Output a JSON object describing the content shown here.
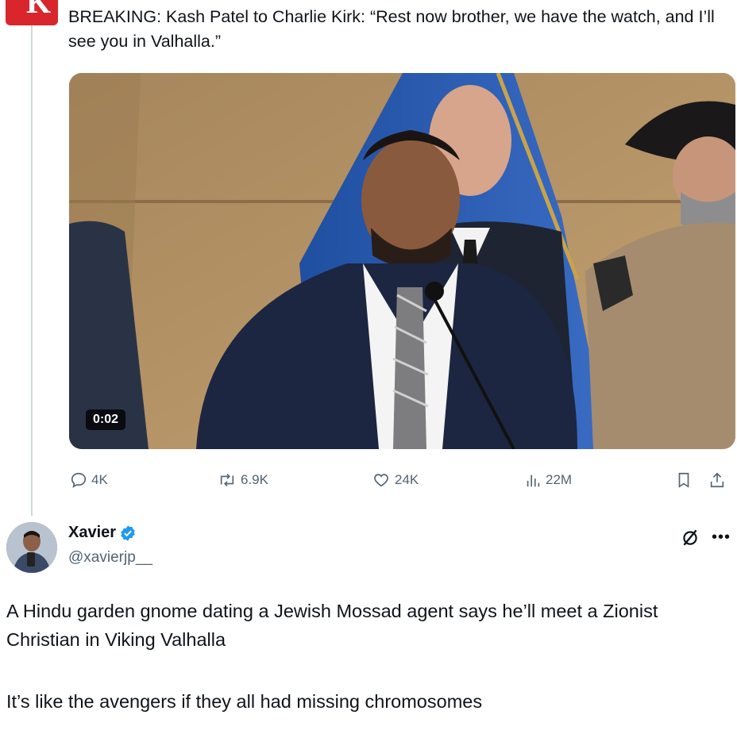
{
  "quoted_post": {
    "avatar_letter": "K",
    "text": "BREAKING: Kash Patel to Charlie Kirk: “Rest now brother, we have the watch, and I’ll see you in Valhalla.”",
    "video": {
      "duration": "0:02"
    },
    "actions": {
      "replies": "4K",
      "reposts": "6.9K",
      "likes": "24K",
      "views": "22M"
    }
  },
  "reply_post": {
    "author_name": "Xavier",
    "author_handle": "@xavierjp__",
    "verified": true,
    "text_line_1": "A Hindu garden gnome dating a Jewish Mossad agent says he’ll meet a Zionist Christian in Viking Valhalla",
    "text_line_2": "It’s like the avengers if they all had missing chromosomes"
  },
  "colors": {
    "verified_blue": "#1d9bf0",
    "muted_text": "#536471",
    "avatar_red": "#d8262c"
  }
}
